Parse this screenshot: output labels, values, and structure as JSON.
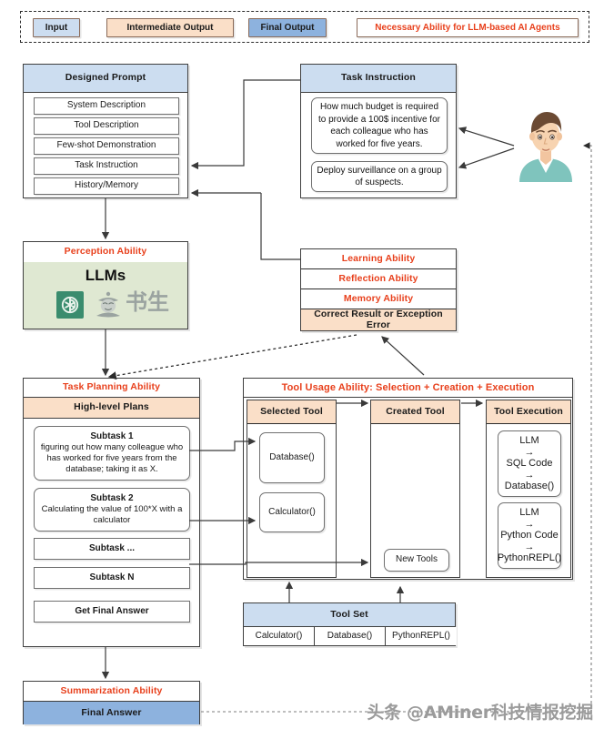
{
  "legend": {
    "items": [
      {
        "label": "Input",
        "color": "#ccddf0",
        "text_color": "#1b1b1b"
      },
      {
        "label": "Intermediate Output",
        "color": "#fadfc8",
        "text_color": "#1b1b1b"
      },
      {
        "label": "Final Output",
        "color": "#8db2de",
        "text_color": "#1b1b1b"
      },
      {
        "label": "Necessary Ability for LLM-based AI Agents",
        "color": "#ffffff",
        "text_color": "#e8401c"
      }
    ]
  },
  "designed_prompt": {
    "title": "Designed Prompt",
    "items": [
      "System Description",
      "Tool Description",
      "Few-shot Demonstration",
      "Task Instruction",
      "History/Memory"
    ]
  },
  "task_instruction": {
    "title": "Task Instruction",
    "items": [
      "How much budget is required to provide a 100$ incentive for each colleague who has worked for five years.",
      "Deploy surveillance on a group of suspects."
    ]
  },
  "perception": {
    "title": "Perception Ability",
    "body_label": "LLMs",
    "logos": [
      "openai-logo",
      "internlm-shusheng-logo"
    ],
    "logo_text": "书生",
    "bg_color": "#dfe8d2"
  },
  "abilities": {
    "rows": [
      "Learning Ability",
      "Reflection Ability",
      "Memory Ability"
    ],
    "result": "Correct Result or Exception Error"
  },
  "task_planning": {
    "title": "Task Planning Ability",
    "subtitle": "High-level Plans",
    "subtasks": [
      {
        "title": "Subtask 1",
        "body": "figuring out how many colleague who has worked for five years from the database; taking it as X."
      },
      {
        "title": "Subtask 2",
        "body": "Calculating the value of 100*X with a calculator"
      },
      {
        "title": "Subtask ...",
        "body": ""
      },
      {
        "title": "Subtask N",
        "body": ""
      },
      {
        "title": "Get Final Answer",
        "body": ""
      }
    ]
  },
  "tool_usage": {
    "title": "Tool Usage Ability: Selection + Creation + Execution",
    "columns": [
      {
        "header": "Selected Tool",
        "items": [
          "Database()",
          "Calculator()"
        ]
      },
      {
        "header": "Created Tool",
        "items": [
          "New Tools"
        ]
      },
      {
        "header": "Tool Execution",
        "items": [
          "LLM\n→\nSQL Code\n→\nDatabase()",
          "LLM\n→\nPython Code\n→\nPythonREPL()"
        ]
      }
    ]
  },
  "tool_set": {
    "title": "Tool Set",
    "tools": [
      "Calculator()",
      "Database()",
      "PythonREPL()"
    ]
  },
  "summarization": {
    "title": "Summarization Ability",
    "answer": "Final Answer"
  },
  "watermark": "头条 @AMiner科技情报挖掘"
}
